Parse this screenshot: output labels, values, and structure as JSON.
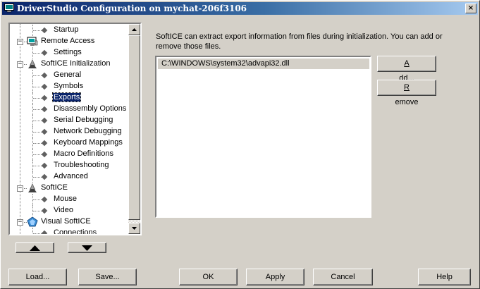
{
  "window": {
    "title": "DriverStudio Configuration on mychat-206f3106",
    "close_glyph": "×"
  },
  "tree": {
    "items": [
      {
        "label": "Startup",
        "level": 2,
        "kind": "leaf"
      },
      {
        "label": "Remote Access",
        "level": 1,
        "kind": "node",
        "icon": "monitor-icon",
        "expander": "−"
      },
      {
        "label": "Settings",
        "level": 2,
        "kind": "leaf"
      },
      {
        "label": "SoftICE Initialization",
        "level": 1,
        "kind": "node",
        "icon": "softice-icon",
        "expander": "−"
      },
      {
        "label": "General",
        "level": 2,
        "kind": "leaf"
      },
      {
        "label": "Symbols",
        "level": 2,
        "kind": "leaf"
      },
      {
        "label": "Exports",
        "level": 2,
        "kind": "leaf",
        "selected": true
      },
      {
        "label": "Disassembly Options",
        "level": 2,
        "kind": "leaf"
      },
      {
        "label": "Serial Debugging",
        "level": 2,
        "kind": "leaf"
      },
      {
        "label": "Network Debugging",
        "level": 2,
        "kind": "leaf"
      },
      {
        "label": "Keyboard Mappings",
        "level": 2,
        "kind": "leaf"
      },
      {
        "label": "Macro Definitions",
        "level": 2,
        "kind": "leaf"
      },
      {
        "label": "Troubleshooting",
        "level": 2,
        "kind": "leaf"
      },
      {
        "label": "Advanced",
        "level": 2,
        "kind": "leaf"
      },
      {
        "label": "SoftICE",
        "level": 1,
        "kind": "node",
        "icon": "softice-icon",
        "expander": "−"
      },
      {
        "label": "Mouse",
        "level": 2,
        "kind": "leaf"
      },
      {
        "label": "Video",
        "level": 2,
        "kind": "leaf"
      },
      {
        "label": "Visual SoftICE",
        "level": 1,
        "kind": "node",
        "icon": "visual-softice-icon",
        "expander": "−"
      },
      {
        "label": "Connections",
        "level": 2,
        "kind": "leaf"
      }
    ]
  },
  "exports": {
    "description": "SoftICE can extract export information from files during initialization.  You can add or remove those files.",
    "files": [
      "C:\\WINDOWS\\system32\\advapi32.dll"
    ],
    "add_label_u": "A",
    "add_label_rest": "dd...",
    "remove_label_u": "R",
    "remove_label_rest": "emove"
  },
  "footer": {
    "load_label": "Load...",
    "save_label": "Save...",
    "ok_label": "OK",
    "apply_label": "Apply",
    "cancel_label": "Cancel",
    "help_label": "Help"
  },
  "colors": {
    "titlebar_start": "#0a246a",
    "titlebar_end": "#a6caf0",
    "selection": "#0a246a",
    "face": "#d4d0c8"
  }
}
